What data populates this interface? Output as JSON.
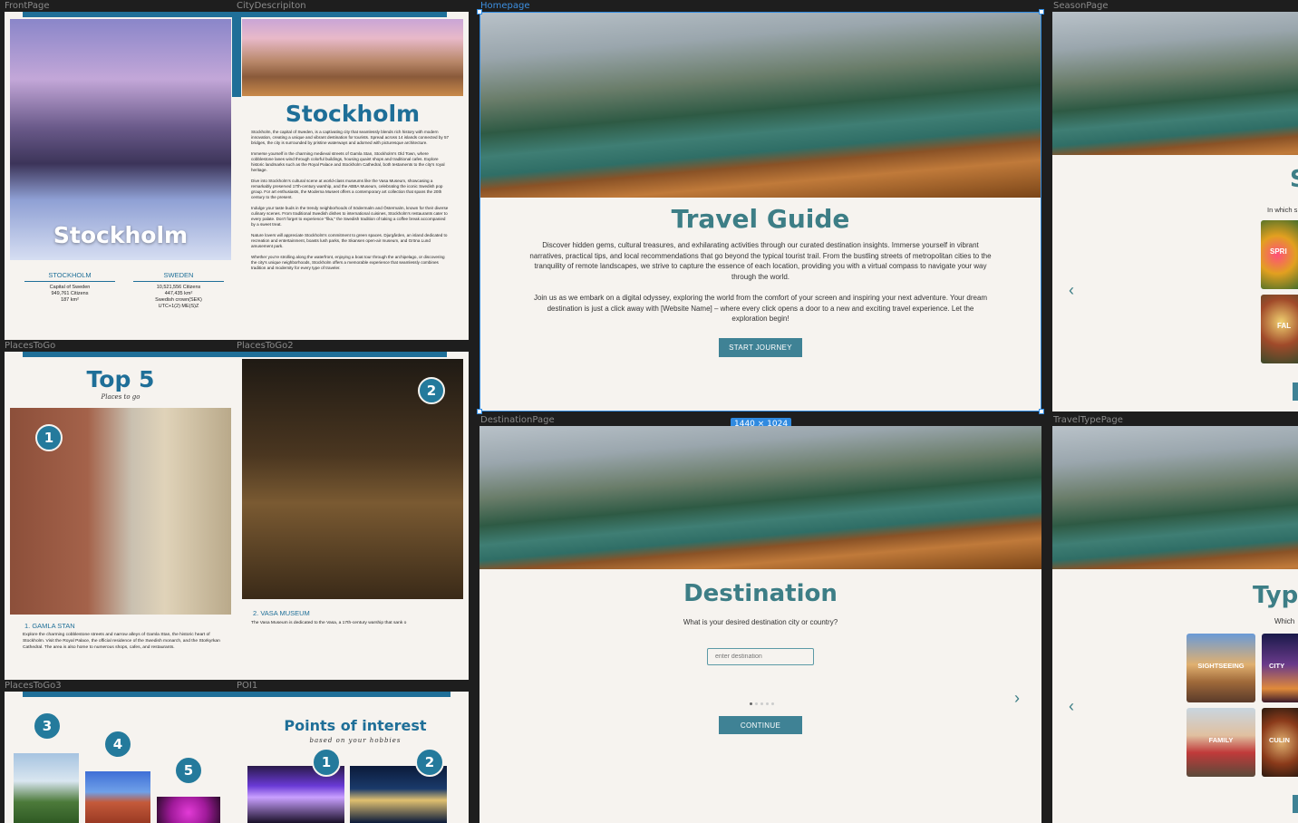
{
  "labels": {
    "front_page": "FrontPage",
    "city_description": "CityDescripiton",
    "homepage": "Homepage",
    "season_page": "SeasonPage",
    "places_to_go": "PlacesToGo",
    "places_to_go2": "PlacesToGo2",
    "destination_page": "DestinationPage",
    "travel_type_page": "TravelTypePage",
    "places_to_go3": "PlacesToGo3",
    "poi1": "POI1"
  },
  "selection_size": "1440 × 1024",
  "front_page": {
    "title": "Stockholm",
    "col1": {
      "heading": "STOCKHOLM",
      "lines": [
        "Capital of Sweden",
        "949,761 Citizens",
        "187 km²"
      ]
    },
    "col2": {
      "heading": "SWEDEN",
      "lines": [
        "10,521,556 Citizens",
        "447,435 km²",
        "Swedish crown(SEK)",
        "UTC+1(2) ME(S)Z"
      ]
    }
  },
  "city_description": {
    "title": "Stockholm",
    "paragraphs": [
      "Stockholm, the capital of Sweden, is a captivating city that seamlessly blends rich history with modern innovation, creating a unique and vibrant destination for tourists. Spread across 14 islands connected by 57 bridges, the city is surrounded by pristine waterways and adorned with picturesque architecture.",
      "Immerse yourself in the charming medieval streets of Gamla Stan, Stockholm's Old Town, where cobblestone lanes wind through colorful buildings, housing quaint shops and traditional cafes. Explore historic landmarks such as the Royal Palace and Stockholm Cathedral, both testaments to the city's royal heritage.",
      "Dive into Stockholm's cultural scene at world-class museums like the Vasa Museum, showcasing a remarkably preserved 17th-century warship, and the ABBA Museum, celebrating the iconic Swedish pop group. For art enthusiasts, the Moderna Museet offers a contemporary art collection that spans the 20th century to the present.",
      "Indulge your taste buds in the trendy neighborhoods of Södermalm and Östermalm, known for their diverse culinary scenes. From traditional Swedish dishes to international cuisines, Stockholm's restaurants cater to every palate. Don't forget to experience \"fika,\" the Swedish tradition of taking a coffee break accompanied by a sweet treat.",
      "Nature lovers will appreciate Stockholm's commitment to green spaces. Djurgården, an island dedicated to recreation and entertainment, boasts lush parks, the Skansen open-air museum, and Gröna Lund amusement park.",
      "Whether you're strolling along the waterfront, enjoying a boat tour through the archipelago, or discovering the city's unique neighborhoods, Stockholm offers a memorable experience that seamlessly combines tradition and modernity for every type of traveler."
    ]
  },
  "homepage": {
    "title": "Travel Guide",
    "paragraph1": "Discover hidden gems, cultural treasures, and exhilarating activities through our curated destination insights. Immerse yourself in vibrant narratives, practical tips, and local recommendations that go beyond the typical tourist trail. From the bustling streets of metropolitan cities to the tranquility of remote landscapes, we strive to capture the essence of each location, providing you with a virtual compass to navigate your way through the world.",
    "paragraph2": "Join us as we embark on a digital odyssey, exploring the world from the comfort of your screen and inspiring your next adventure. Your dream destination is just a click away with [Website Name] – where every click opens a door to a new and exciting travel experience. Let the exploration begin!",
    "button": "START JOURNEY"
  },
  "season_page": {
    "title_fragment": "S",
    "subtitle_fragment": "In which s",
    "card1": "SPRI",
    "card2": "FAL",
    "prev_arrow": "‹"
  },
  "places_to_go": {
    "title": "Top 5",
    "subtitle": "Places to go",
    "badge": "1",
    "item_title": "1. GAMLA STAN",
    "item_text": "Explore the charming cobblestone streets and narrow alleys of Gamla Stan, the historic heart of Stockholm. Visit the Royal Palace, the official residence of the Swedish monarch, and the Storkyrkan Cathedral. The area is also home to numerous shops, cafes, and restaurants."
  },
  "places_to_go2": {
    "badge": "2",
    "item_title": "2. VASA MUSEUM",
    "item_text": "The Vasa Museum is dedicated to the Vasa, a 17th-century warship that sank o"
  },
  "destination_page": {
    "title": "Destination",
    "question": "What is your desired destination city or country?",
    "placeholder": "enter destination",
    "button": "CONTINUE",
    "next_arrow": "›"
  },
  "travel_type_page": {
    "title_fragment": "Typ",
    "subtitle_fragment": "Which",
    "cards": [
      "SIGHTSEEING",
      "CITY",
      "FAMILY",
      "CULIN"
    ],
    "prev_arrow": "‹"
  },
  "places_to_go3": {
    "badges": [
      "3",
      "4",
      "5"
    ]
  },
  "poi1": {
    "title": "Points of interest",
    "subtitle": "based on your hobbies",
    "badges": [
      "1",
      "2"
    ]
  }
}
